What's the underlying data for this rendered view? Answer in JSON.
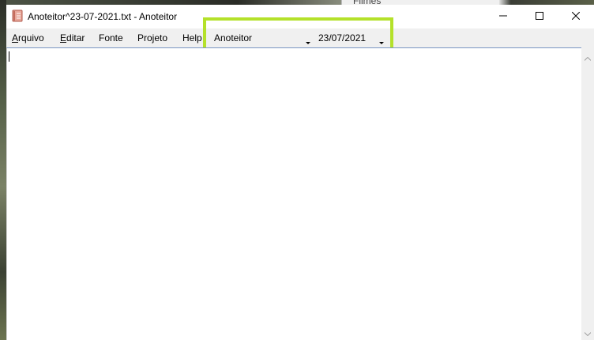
{
  "background_window": {
    "title": "Filmes"
  },
  "window": {
    "title": "Anoteitor^23-07-2021.txt - Anoteitor",
    "icon": "notebook-icon"
  },
  "title_buttons": {
    "minimize_icon": "minimize-icon",
    "maximize_icon": "maximize-icon",
    "close_icon": "close-icon"
  },
  "menu": {
    "items": [
      {
        "label_ul": "A",
        "label_rest": "rquivo"
      },
      {
        "label_ul": "E",
        "label_rest": "ditar"
      },
      {
        "label_ul": "",
        "label_rest": "Fonte"
      },
      {
        "label_ul": "",
        "label_rest": "Projeto"
      },
      {
        "label_ul": "",
        "label_rest": "Help"
      }
    ]
  },
  "project_select": {
    "value": "Anoteitor"
  },
  "date_select": {
    "value": "23/07/2021"
  },
  "editor": {
    "text": ""
  },
  "colors": {
    "highlight": "#b4e12a",
    "menubar": "#f0f0f0",
    "editor_border": "#7a96c2"
  }
}
